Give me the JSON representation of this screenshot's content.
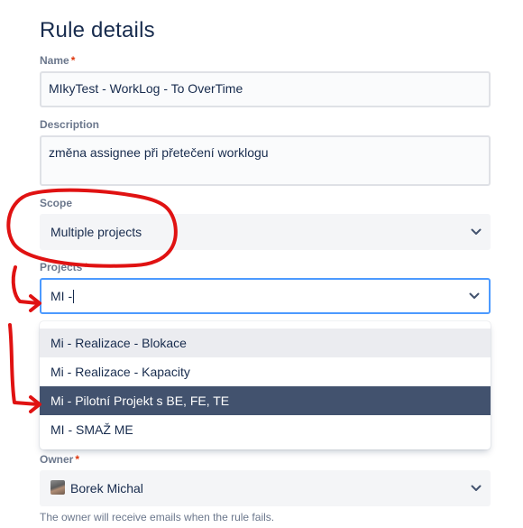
{
  "page": {
    "title": "Rule details"
  },
  "name": {
    "label": "Name",
    "required": "*",
    "value": "MIkyTest - WorkLog - To OverTime"
  },
  "description": {
    "label": "Description",
    "value": "změna assignee při přetečení worklogu"
  },
  "scope": {
    "label": "Scope",
    "value": "Multiple projects"
  },
  "projects": {
    "label": "Projects",
    "required": "*",
    "input_value": "MI -",
    "options": [
      {
        "label": "Mi - Realizace - Blokace",
        "state": "hover"
      },
      {
        "label": "Mi - Realizace - Kapacity",
        "state": "normal"
      },
      {
        "label": "Mi - Pilotní Projekt s BE, FE, TE",
        "state": "selected"
      },
      {
        "label": "MI - SMAŽ ME",
        "state": "normal"
      }
    ]
  },
  "owner": {
    "label": "Owner",
    "required": "*",
    "value": "Borek Michal",
    "avatar_icon": "user-avatar",
    "help_text": "The owner will receive emails when the rule fails."
  },
  "colors": {
    "accent_focus": "#4c9aff",
    "selected_option": "#42526e",
    "required": "#de350b",
    "annotation_red": "#e01212"
  },
  "icons": [
    "chevron-down-icon"
  ]
}
